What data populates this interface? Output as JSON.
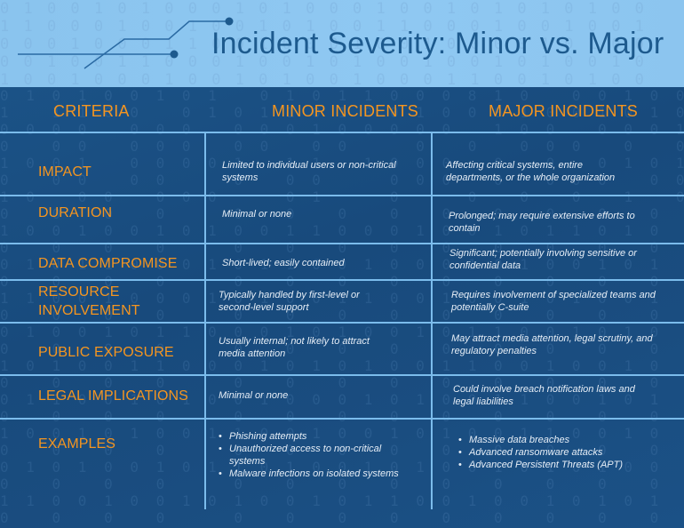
{
  "header": {
    "title": "Incident Severity: Minor vs. Major"
  },
  "table": {
    "columns": {
      "criteria": "CRITERIA",
      "minor": "MINOR INCIDENTS",
      "major": "MAJOR INCIDENTS"
    },
    "rows": [
      {
        "criterion": "IMPACT",
        "minor": "Limited to individual users or non-critical systems",
        "major": "Affecting critical systems, entire departments, or the whole organization"
      },
      {
        "criterion": "DURATION",
        "minor": "Minimal or none",
        "major": "Prolonged; may require extensive efforts to contain"
      },
      {
        "criterion": "DATA COMPROMISE",
        "minor": "Short-lived; easily contained",
        "major": "Significant; potentially involving sensitive or confidential data"
      },
      {
        "criterion": "RESOURCE INVOLVEMENT",
        "minor": "Typically handled by first-level or second-level support",
        "major": "Requires involvement of specialized teams and potentially C-suite"
      },
      {
        "criterion": "PUBLIC EXPOSURE",
        "minor": "Usually internal; not likely to attract media attention",
        "major": "May attract media attention, legal scrutiny, and regulatory penalties"
      },
      {
        "criterion": "LEGAL IMPLICATIONS",
        "minor": "Minimal or none",
        "major": "Could involve breach notification laws and legal liabilities"
      }
    ],
    "examples": {
      "criterion": "EXAMPLES",
      "minor": [
        "Phishing attempts",
        "Unauthorized access to non-critical systems",
        "Malware infections on isolated systems"
      ],
      "major": [
        "Massive data breaches",
        "Advanced ransomware attacks",
        "Advanced Persistent Threats (APT)"
      ]
    }
  },
  "colors": {
    "banner": "#8cc6f0",
    "title": "#1d5a8e",
    "background": "#1a4b7d",
    "grid": "#7bbcec",
    "accent": "#f49520",
    "cell_text": "#e6eef7"
  }
}
